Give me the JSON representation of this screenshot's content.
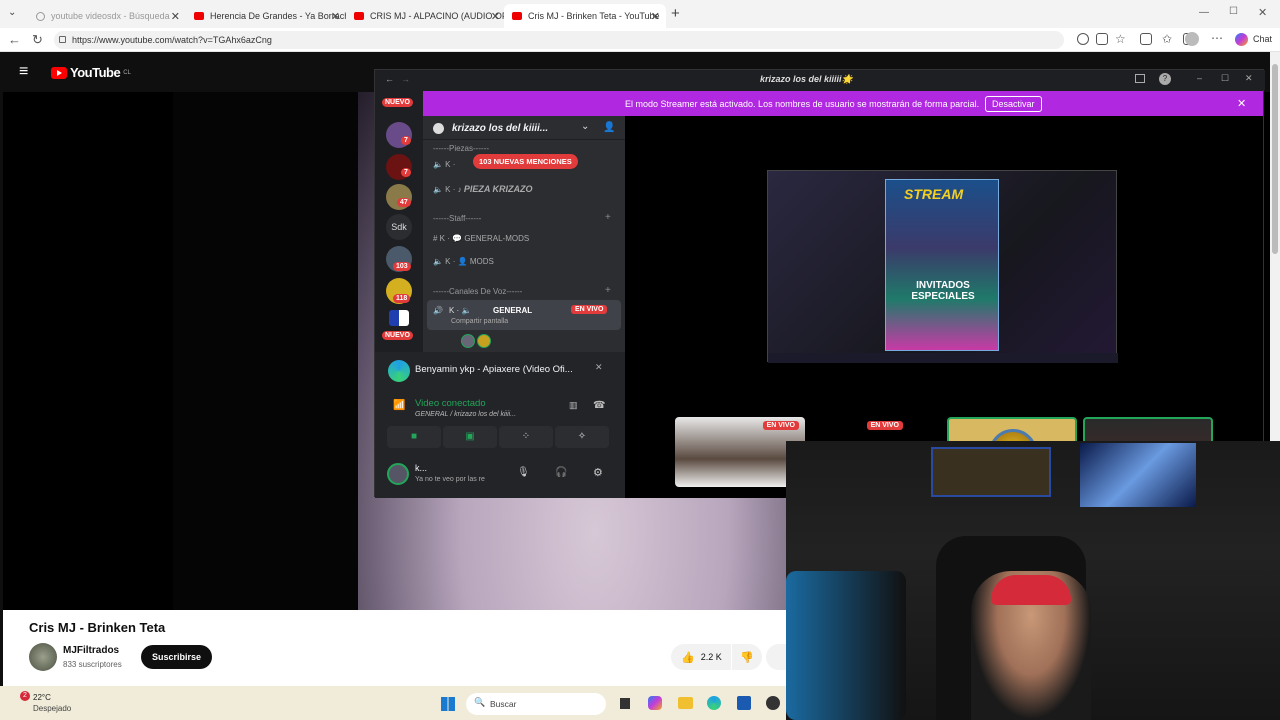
{
  "browser": {
    "tabs": [
      {
        "label": "youtube videosdx - Búsqueda"
      },
      {
        "label": "Herencia De Grandes - Ya Borracho"
      },
      {
        "label": "CRIS MJ - ALPACINO (AUDIO OFIC"
      },
      {
        "label": "Cris MJ - Brinken Teta - YouTube"
      }
    ],
    "url": "https://www.youtube.com/watch?v=TGAhx6azCng",
    "chat_label": "Chat"
  },
  "youtube": {
    "logo": "YouTube",
    "region": "CL",
    "video_title": "Cris MJ - Brinken Teta",
    "channel_name": "MJFiltrados",
    "subscribers": "833 suscriptores",
    "subscribe_label": "Suscribirse",
    "likes": "2.2 K"
  },
  "discord": {
    "window_title": "krizazo los del kiiiii🌟",
    "banner_text": "El modo Streamer está activado. Los nombres de usuario se mostrarán de forma parcial.",
    "banner_button": "Desactivar",
    "server_name": "krizazo los del kiiii...",
    "mentions_pill": "103 NUEVAS MENCIONES",
    "guild_badges": [
      "NUEVO",
      "7",
      "7",
      "47",
      "Sdk",
      "103",
      "118",
      "NUEVO"
    ],
    "categories": {
      "piezas": "------Piezas------",
      "staff": "------Staff------",
      "voz": "------Canales De Voz------"
    },
    "channels": {
      "pieza": "PIEZA KRIZAZO",
      "general_mods": "GENERAL-MODS",
      "mods": "MODS",
      "general": "GENERAL",
      "share": "Compartir pantalla"
    },
    "live_label": "EN VIVO",
    "activity": "Benyamin ykp - Apiaxere (Video Ofi...",
    "voice_status": "Video conectado",
    "voice_location": "GENERAL / krizazo los del kiiii...",
    "user_name": "k...",
    "user_status": "Ya no te veo por las re",
    "stream_title": "STREAM",
    "stream_subtitle": "INVITADOS ESPECIALES"
  },
  "taskbar": {
    "temperature": "22°C",
    "weather": "Despejado",
    "search": "Buscar",
    "weather_badge": "2"
  }
}
